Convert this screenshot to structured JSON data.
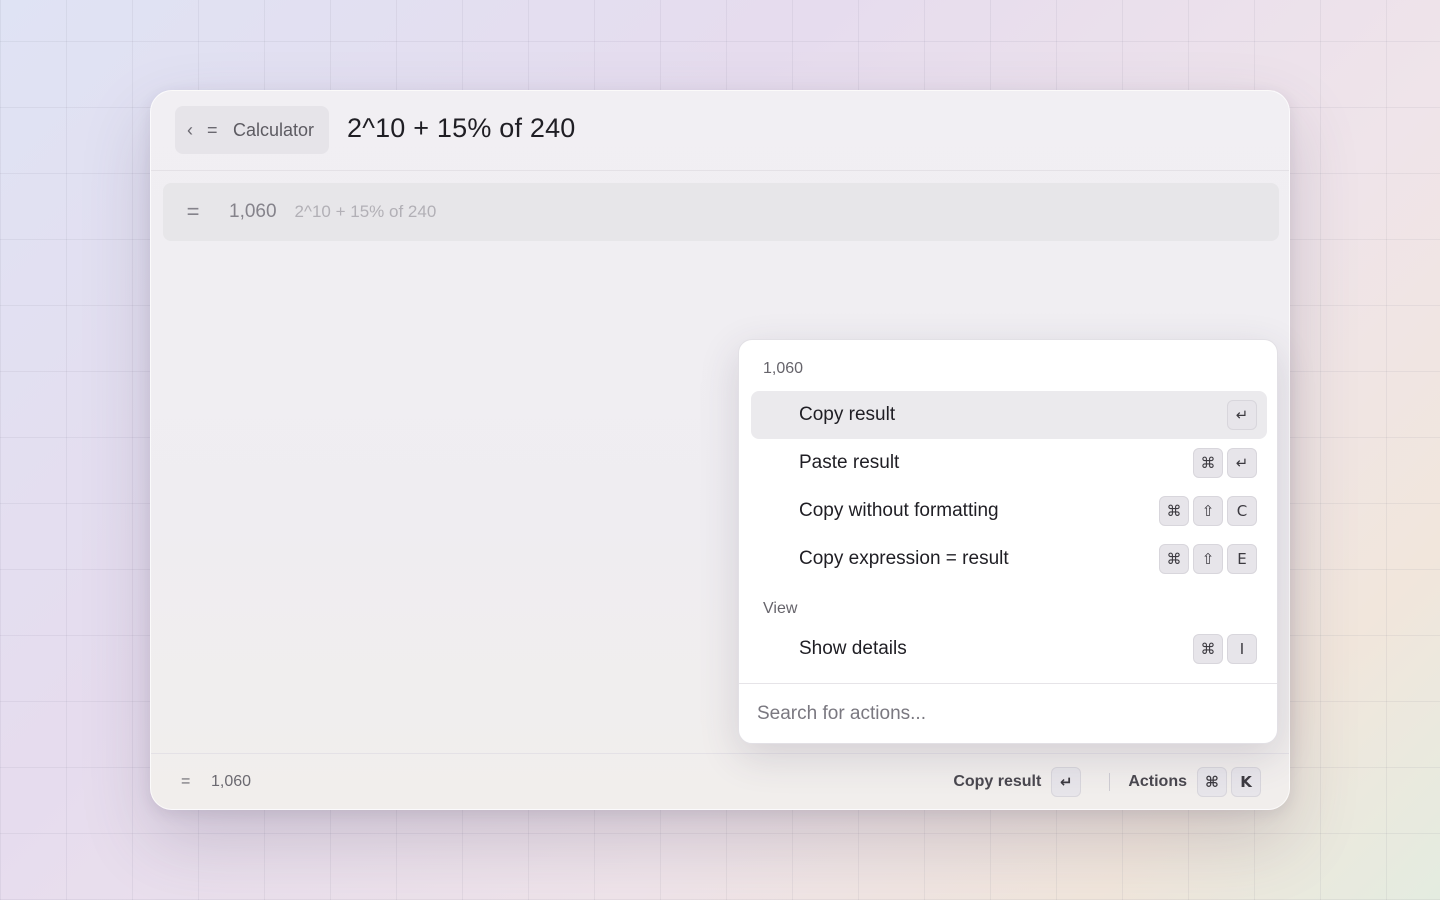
{
  "header": {
    "back_icon": "chevron-left-icon",
    "back_glyph": "‹",
    "mode_glyph": "=",
    "mode_label": "Calculator",
    "query": "2^10 + 15% of 240"
  },
  "result": {
    "glyph": "=",
    "value": "1,060",
    "expression": "2^10 + 15% of 240"
  },
  "actions_panel": {
    "title": "1,060",
    "items": [
      {
        "label": "Copy result",
        "keys": [
          "↵"
        ],
        "selected": true
      },
      {
        "label": "Paste result",
        "keys": [
          "⌘",
          "↵"
        ]
      },
      {
        "label": "Copy without formatting",
        "keys": [
          "⌘",
          "⇧",
          "C"
        ]
      },
      {
        "label": "Copy expression = result",
        "keys": [
          "⌘",
          "⇧",
          "E"
        ]
      }
    ],
    "section_view": "View",
    "view_items": [
      {
        "label": "Show details",
        "keys": [
          "⌘",
          "I"
        ]
      }
    ],
    "search_placeholder": "Search for actions..."
  },
  "footer": {
    "glyph": "=",
    "value": "1,060",
    "primary_action": "Copy result",
    "primary_keys": [
      "↵"
    ],
    "actions_label": "Actions",
    "actions_keys": [
      "⌘",
      "K"
    ]
  }
}
